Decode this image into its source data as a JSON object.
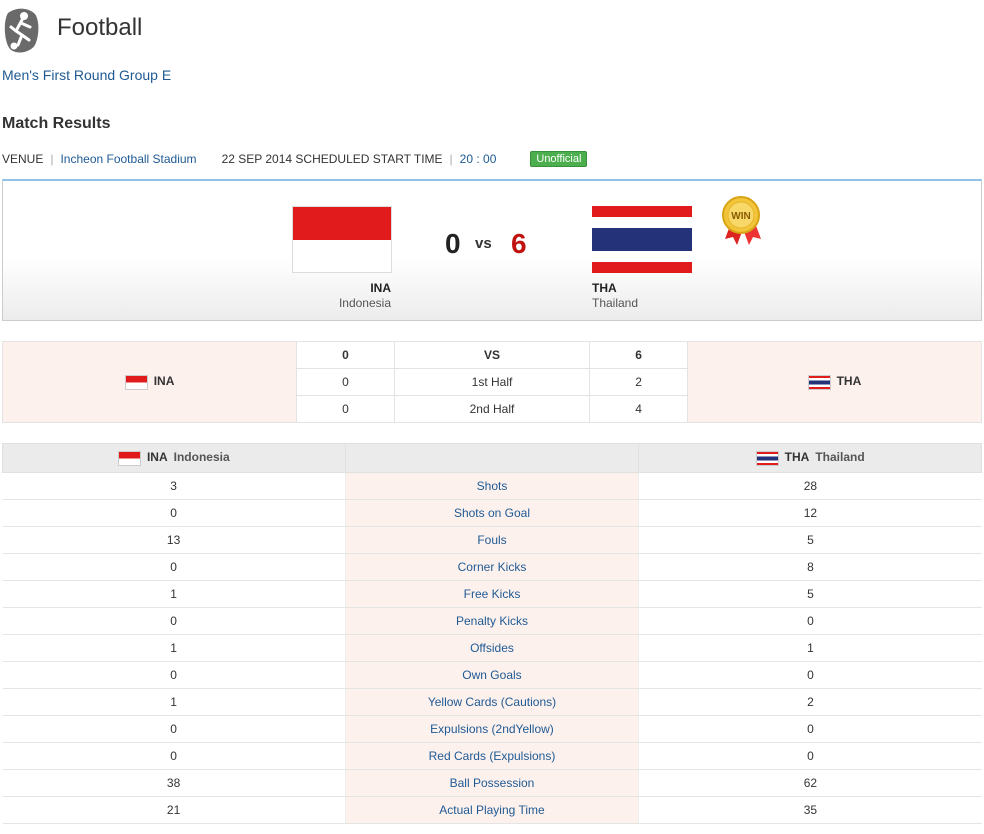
{
  "header": {
    "title": "Football",
    "icon": "football-player-icon"
  },
  "event": {
    "name": "Men's First Round Group E"
  },
  "section": {
    "title": "Match Results"
  },
  "venue": {
    "label": "VENUE",
    "stadium": "Incheon Football Stadium",
    "date_text": "22 SEP 2014 SCHEDULED START TIME",
    "time": "20 : 00",
    "status": "Unofficial"
  },
  "match": {
    "home": {
      "code": "INA",
      "name": "Indonesia",
      "score": "0"
    },
    "away": {
      "code": "THA",
      "name": "Thailand",
      "score": "6"
    },
    "vs": "VS",
    "vs_big": "vs",
    "winner_badge": "WIN"
  },
  "halves": [
    {
      "home": "0",
      "label": "VS",
      "away": "6"
    },
    {
      "home": "0",
      "label": "1st Half",
      "away": "2"
    },
    {
      "home": "0",
      "label": "2nd Half",
      "away": "4"
    }
  ],
  "stats": [
    {
      "home": "3",
      "label": "Shots",
      "away": "28"
    },
    {
      "home": "0",
      "label": "Shots on Goal",
      "away": "12"
    },
    {
      "home": "13",
      "label": "Fouls",
      "away": "5"
    },
    {
      "home": "0",
      "label": "Corner Kicks",
      "away": "8"
    },
    {
      "home": "1",
      "label": "Free Kicks",
      "away": "5"
    },
    {
      "home": "0",
      "label": "Penalty Kicks",
      "away": "0"
    },
    {
      "home": "1",
      "label": "Offsides",
      "away": "1"
    },
    {
      "home": "0",
      "label": "Own Goals",
      "away": "0"
    },
    {
      "home": "1",
      "label": "Yellow Cards (Cautions)",
      "away": "2"
    },
    {
      "home": "0",
      "label": "Expulsions (2ndYellow)",
      "away": "0"
    },
    {
      "home": "0",
      "label": "Red Cards (Expulsions)",
      "away": "0"
    },
    {
      "home": "38",
      "label": "Ball Possession",
      "away": "62"
    },
    {
      "home": "21",
      "label": "Actual Playing Time",
      "away": "35"
    }
  ],
  "colors": {
    "link": "#1f5a93",
    "badge": "#4cae4c",
    "winner_score": "#c0120f",
    "accent_border": "#8fc3e8"
  }
}
